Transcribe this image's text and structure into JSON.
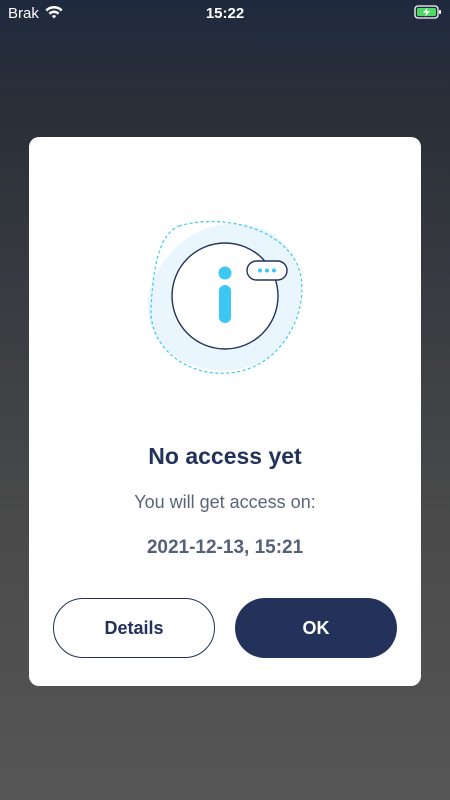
{
  "status_bar": {
    "carrier": "Brak",
    "time": "15:22",
    "wifi_icon": "wifi-icon",
    "battery_icon": "battery-charging-icon",
    "battery_color": "#4cd964"
  },
  "dialog": {
    "icon": "info-icon",
    "title": "No access yet",
    "subtitle": "You will get access on:",
    "access_date": "2021-12-13, 15:21",
    "details_label": "Details",
    "ok_label": "OK",
    "accent_color": "#3cc8f0",
    "primary_color": "#22325a"
  }
}
